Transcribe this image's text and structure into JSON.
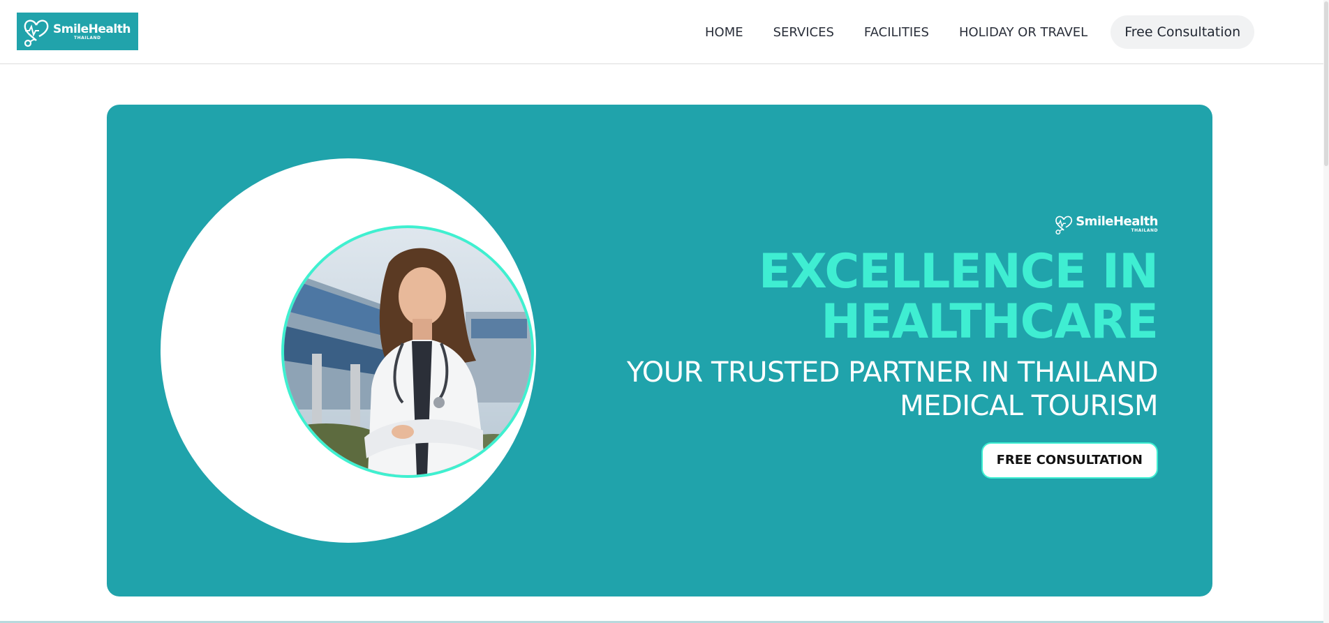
{
  "brand": {
    "name": "SmileHealth",
    "subname": "THAILAND",
    "accent_color": "#20a3ab",
    "highlight_color": "#3feed2"
  },
  "nav": {
    "items": [
      {
        "label": "HOME"
      },
      {
        "label": "SERVICES"
      },
      {
        "label": "FACILITIES"
      },
      {
        "label": "HOLIDAY OR TRAVEL"
      }
    ],
    "cta_label": "Free Consultation"
  },
  "hero": {
    "headline_line1": "EXCELLENCE IN",
    "headline_line2": "HEALTHCARE",
    "subline_line1": "YOUR TRUSTED PARTNER IN THAILAND",
    "subline_line2": "MEDICAL TOURISM",
    "button_label": "FREE CONSULTATION"
  },
  "icons": {
    "logo": "heart-stethoscope-icon"
  }
}
